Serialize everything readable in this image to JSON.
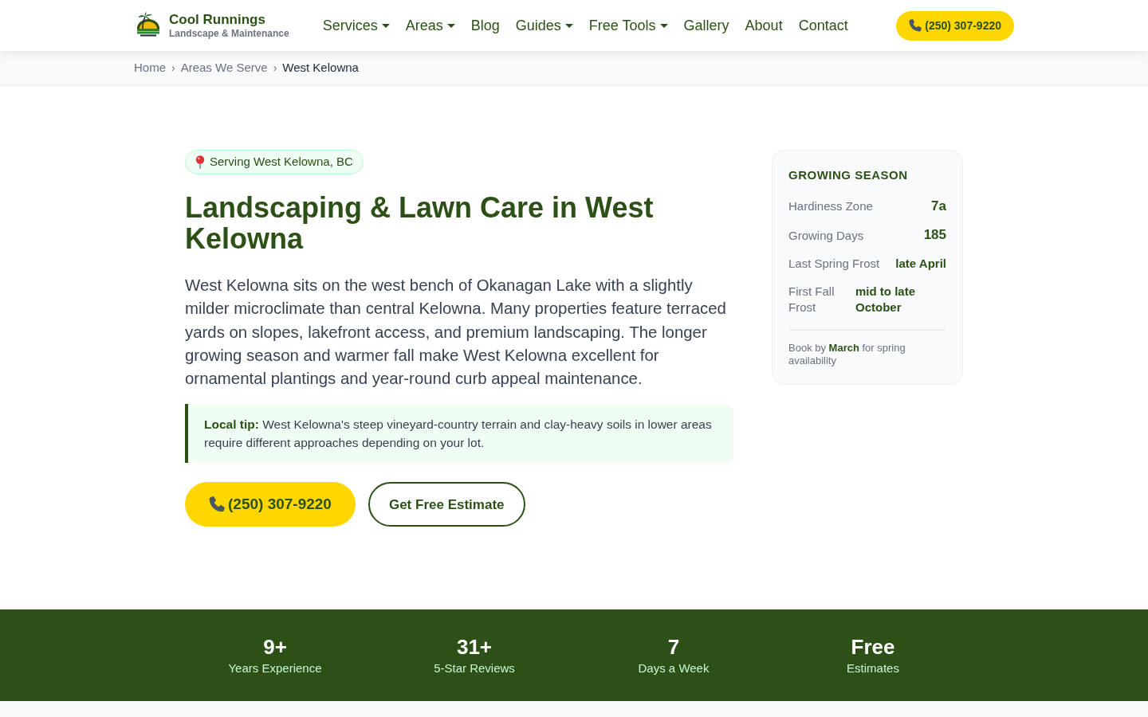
{
  "brand": {
    "name": "Cool Runnings",
    "tagline": "Landscape & Maintenance"
  },
  "nav": {
    "items": [
      {
        "label": "Services",
        "dropdown": true
      },
      {
        "label": "Areas",
        "dropdown": true
      },
      {
        "label": "Blog",
        "dropdown": false
      },
      {
        "label": "Guides",
        "dropdown": true
      },
      {
        "label": "Free Tools",
        "dropdown": true
      },
      {
        "label": "Gallery",
        "dropdown": false
      },
      {
        "label": "About",
        "dropdown": false
      },
      {
        "label": "Contact",
        "dropdown": false
      }
    ],
    "phone_button": "(250) 307-9220"
  },
  "breadcrumb": [
    {
      "label": "Home",
      "current": false,
      "separator": "›"
    },
    {
      "label": "Areas We Serve",
      "current": false,
      "separator": "›"
    },
    {
      "label": "West Kelowna",
      "current": true
    }
  ],
  "hero": {
    "location_badge": "Serving West Kelowna, BC",
    "title": "Landscaping & Lawn Care in West Kelowna",
    "intro": "West Kelowna sits on the west bench of Okanagan Lake with a slightly milder microclimate than central Kelowna. Many properties feature terraced yards on slopes, lakefront access, and premium landscaping. The longer growing season and warmer fall make West Kelowna excellent for ornamental plantings and year-round curb appeal maintenance.",
    "tip": "**Local tip:** West Kelowna's steep vineyard-country terrain and clay-heavy soils in lower areas require different approaches depending on your lot.",
    "buttons": [
      {
        "kind": "phone",
        "label": "(250) 307-9220"
      },
      {
        "kind": "outline",
        "label": "Get Free Estimate"
      }
    ]
  },
  "season_card": {
    "title": "GROWING SEASON",
    "rows": [
      {
        "label": "Hardiness Zone",
        "value": "7a"
      },
      {
        "label": "Growing Days",
        "value": "185"
      },
      {
        "label": "Last Spring Frost",
        "value": "late April"
      },
      {
        "label": "First Fall Frost",
        "value": "mid to late October"
      }
    ],
    "note": "Book by **March** for spring availability"
  },
  "stats": [
    {
      "value": "9+",
      "label": "Years Experience"
    },
    {
      "value": "31+",
      "label": "5-Star Reviews"
    },
    {
      "value": "7",
      "label": "Days a Week"
    },
    {
      "value": "Free",
      "label": "Estimates"
    }
  ]
}
